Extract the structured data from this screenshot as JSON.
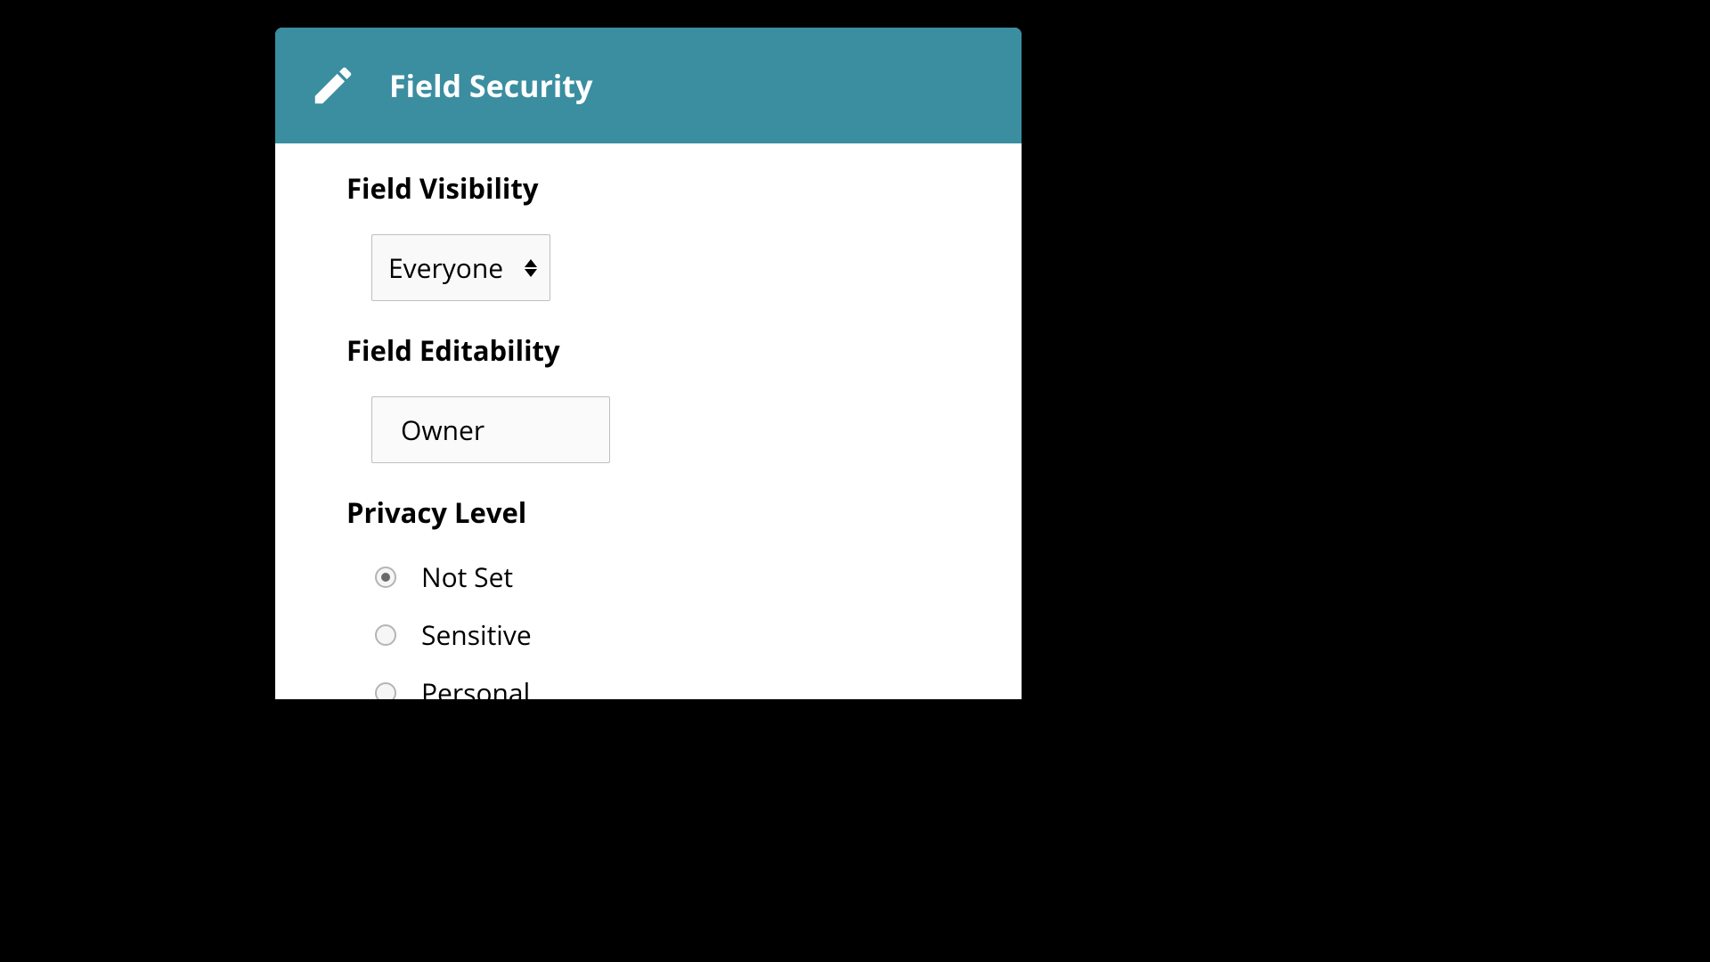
{
  "header": {
    "title": "Field Security",
    "icon": "pencil-icon"
  },
  "sections": {
    "visibility": {
      "label": "Field Visibility",
      "selected": "Everyone"
    },
    "editability": {
      "label": "Field Editability",
      "value": "Owner"
    },
    "privacy": {
      "label": "Privacy Level",
      "options": [
        {
          "label": "Not Set",
          "checked": true
        },
        {
          "label": "Sensitive",
          "checked": false
        },
        {
          "label": "Personal",
          "checked": false
        }
      ]
    }
  }
}
